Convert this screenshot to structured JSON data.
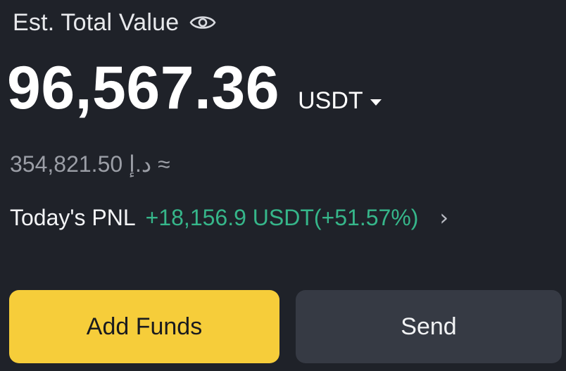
{
  "header": {
    "est_label": "Est. Total Value",
    "eye_icon": "eye-icon"
  },
  "balance": {
    "value": "96,567.36",
    "currency": "USDT",
    "caret_icon": "caret-down-icon"
  },
  "fiat": {
    "text": "354,821.50 د.إ ≈"
  },
  "pnl": {
    "label": "Today's PNL",
    "value": "+18,156.9 USDT(+51.57%)",
    "chevron_icon": "chevron-right-icon",
    "positive_color": "#36b68a"
  },
  "actions": {
    "add_funds": "Add Funds",
    "send": "Send"
  },
  "colors": {
    "background": "#1f2229",
    "accent_yellow": "#f6cd3a",
    "secondary_button": "#363a44"
  }
}
